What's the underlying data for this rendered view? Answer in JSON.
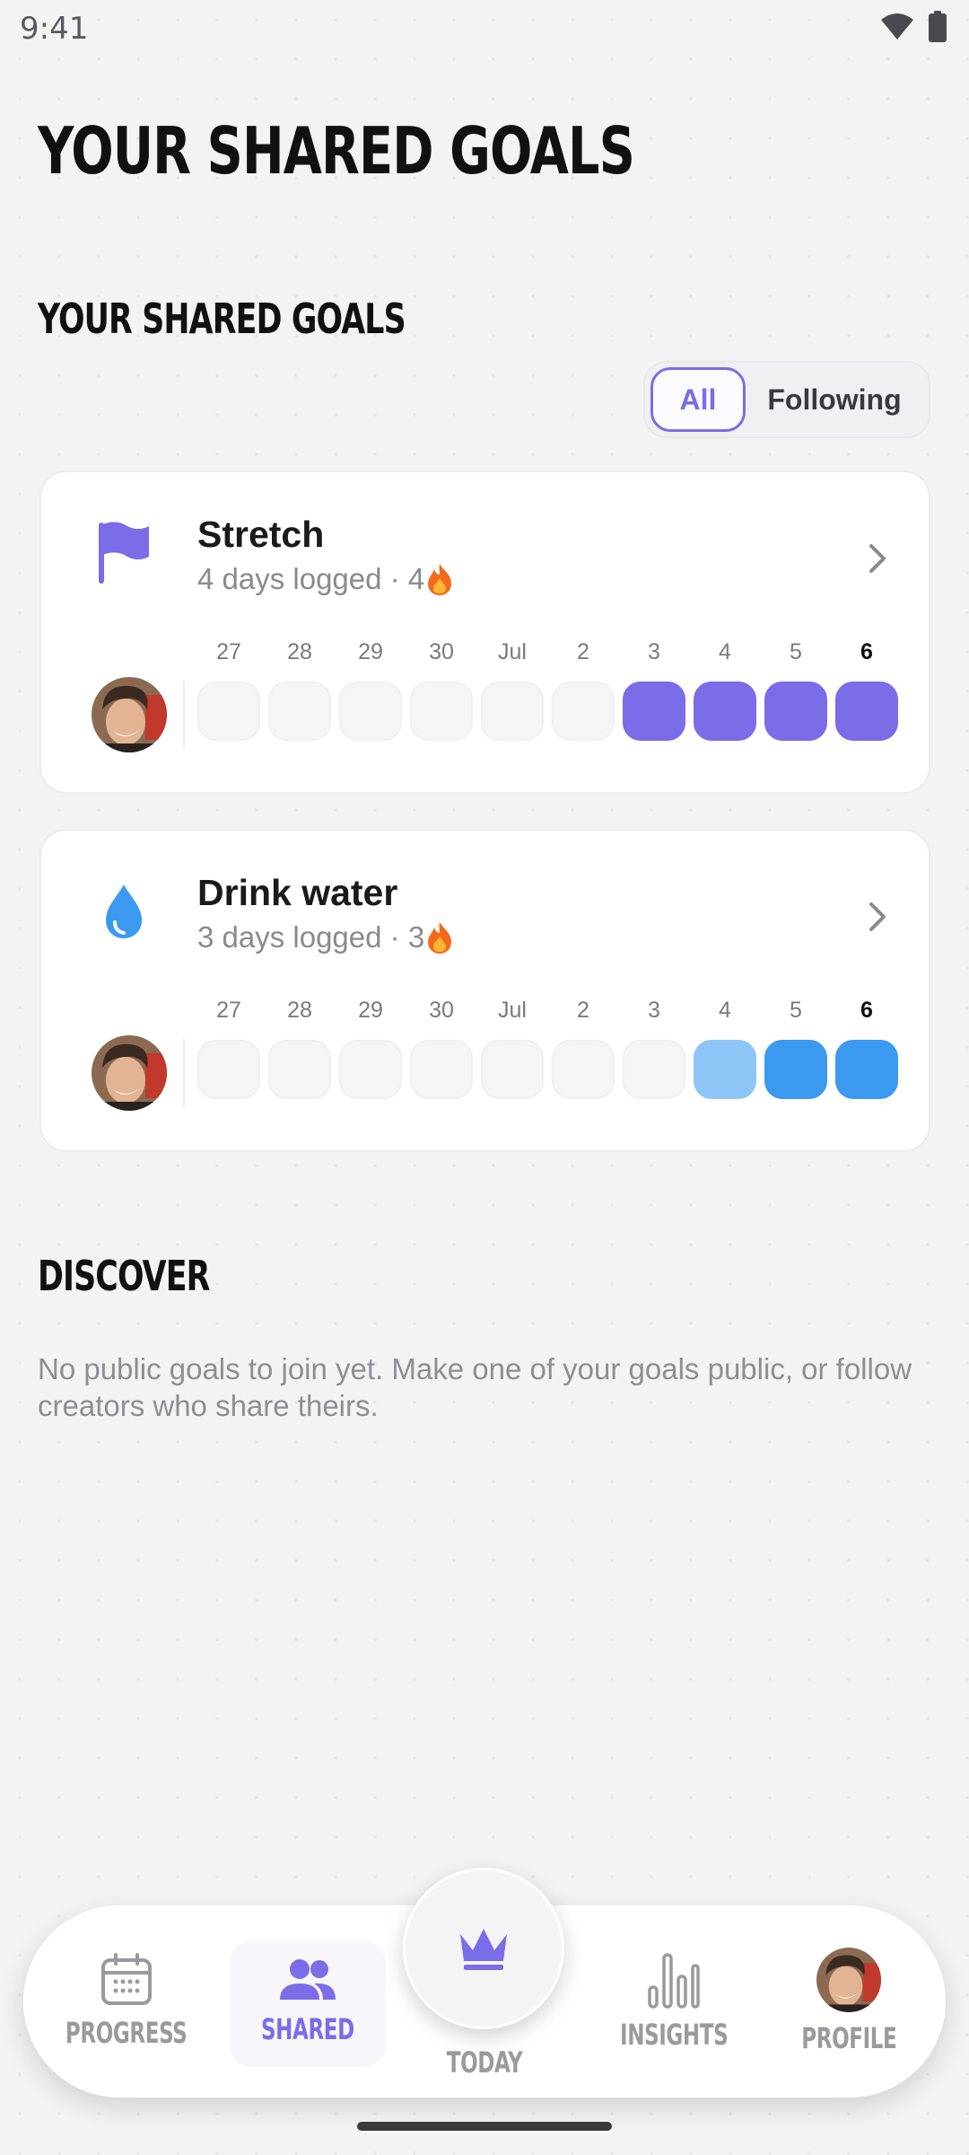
{
  "status_bar": {
    "time": "9:41"
  },
  "page_title": "YOUR SHARED GOALS",
  "section_title": "YOUR SHARED GOALS",
  "filter": {
    "all_label": "All",
    "following_label": "Following",
    "selected": "All"
  },
  "goals": [
    {
      "title": "Stretch",
      "subtitle": "4 days logged · 4",
      "icon": "flag-icon",
      "color": "#7b6ce8",
      "days": [
        "27",
        "28",
        "29",
        "30",
        "Jul",
        "2",
        "3",
        "4",
        "5",
        "6"
      ],
      "logged": [
        0,
        0,
        0,
        0,
        0,
        0,
        1,
        1,
        1,
        1
      ]
    },
    {
      "title": "Drink water",
      "subtitle": "3 days logged · 3",
      "icon": "water-drop-icon",
      "color": "#3b9af0",
      "color_light": "#8ec5f7",
      "days": [
        "27",
        "28",
        "29",
        "30",
        "Jul",
        "2",
        "3",
        "4",
        "5",
        "6"
      ],
      "logged": [
        0,
        0,
        0,
        0,
        0,
        0,
        0,
        0.5,
        1,
        1
      ]
    }
  ],
  "discover": {
    "title": "DISCOVER",
    "empty_text": "No public goals to join yet. Make one of your goals public, or follow creators who share theirs."
  },
  "nav": {
    "progress": "PROGRESS",
    "shared": "SHARED",
    "today": "TODAY",
    "insights": "INSIGHTS",
    "profile": "PROFILE",
    "active": "SHARED"
  },
  "colors": {
    "accent": "#7b6ce8",
    "water": "#3b9af0",
    "streak": "#f26b1d"
  }
}
